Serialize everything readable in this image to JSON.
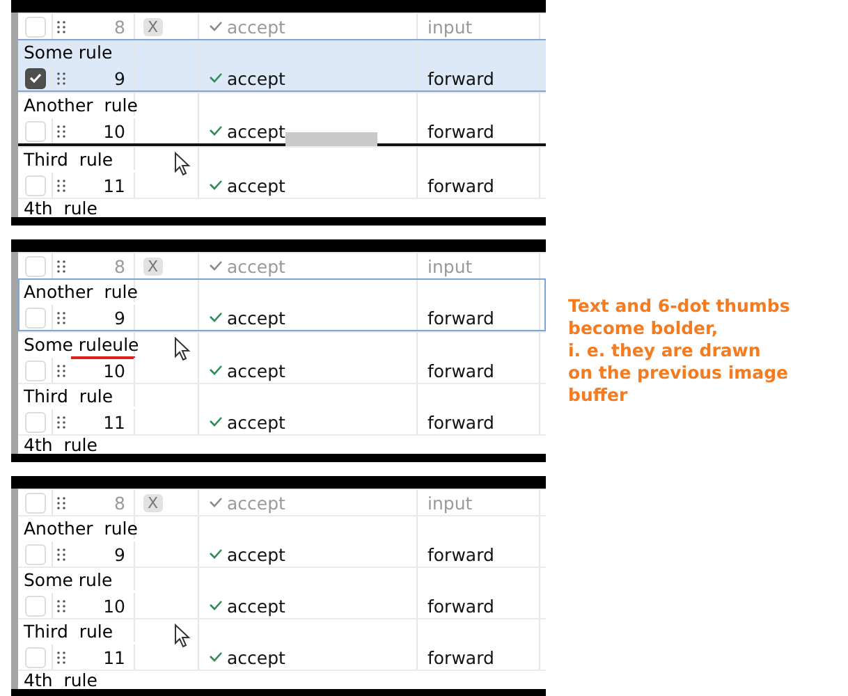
{
  "panels": [
    {
      "rows": [
        {
          "number": "8",
          "badge": "X",
          "action": "accept",
          "direction": "input",
          "disabled": true,
          "selected": false,
          "checked": false
        },
        {
          "name": "Some rule",
          "number": "9",
          "action": "accept",
          "direction": "forward",
          "disabled": false,
          "selected": true,
          "checked": true
        },
        {
          "name": "Another  rule",
          "number": "10",
          "action": "accept",
          "direction": "forward",
          "disabled": false,
          "selected": false,
          "checked": false,
          "drop_target": true
        },
        {
          "name": "Third  rule",
          "number": "11",
          "action": "accept",
          "direction": "forward",
          "disabled": false,
          "selected": false,
          "checked": false,
          "cursor": true
        }
      ],
      "next_name": "4th  rule"
    },
    {
      "rows": [
        {
          "number": "8",
          "badge": "X",
          "action": "accept",
          "direction": "input",
          "disabled": true,
          "selected": false,
          "checked": false
        },
        {
          "name": "Another  rule",
          "number": "9",
          "action": "accept",
          "direction": "forward",
          "disabled": false,
          "selected": false,
          "checked": false,
          "focused": true
        },
        {
          "name": "Some ruleule",
          "number": "10",
          "action": "accept",
          "direction": "forward",
          "disabled": false,
          "selected": false,
          "checked": false,
          "marked": true,
          "cursor": true
        },
        {
          "name": "Third  rule",
          "number": "11",
          "action": "accept",
          "direction": "forward",
          "disabled": false,
          "selected": false,
          "checked": false
        }
      ],
      "next_name": "4th  rule",
      "note": "Text and 6-dot thumbs\nbecome bolder,\ni. e. they are drawn\non the previous image buffer"
    },
    {
      "rows": [
        {
          "number": "8",
          "badge": "X",
          "action": "accept",
          "direction": "input",
          "disabled": true,
          "selected": false,
          "checked": false
        },
        {
          "name": "Another  rule",
          "number": "9",
          "action": "accept",
          "direction": "forward",
          "disabled": false,
          "selected": false,
          "checked": false
        },
        {
          "name": "Some rule",
          "number": "10",
          "action": "accept",
          "direction": "forward",
          "disabled": false,
          "selected": false,
          "checked": false
        },
        {
          "name": "Third  rule",
          "number": "11",
          "action": "accept",
          "direction": "forward",
          "disabled": false,
          "selected": false,
          "checked": false,
          "cursor": true
        }
      ],
      "next_name": "4th  rule"
    }
  ]
}
